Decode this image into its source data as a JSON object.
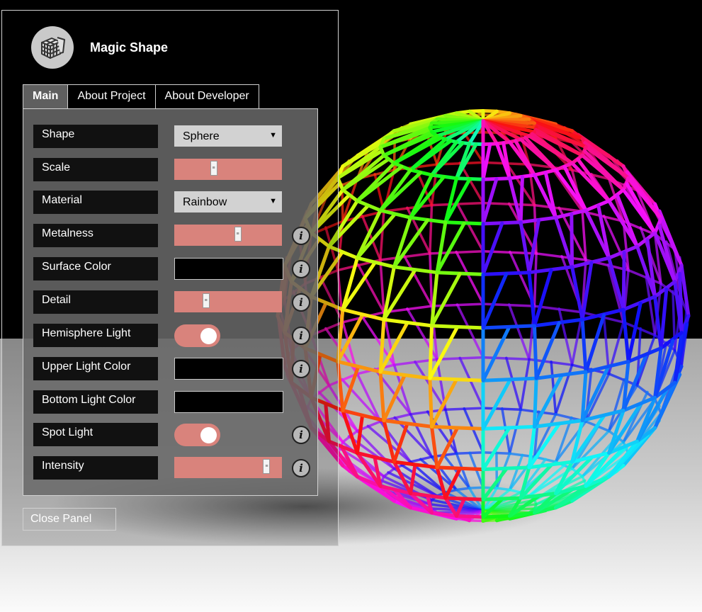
{
  "app": {
    "title": "Magic Shape",
    "logo_icon": "cube-logo-icon"
  },
  "tabs": [
    {
      "label": "Main",
      "active": true
    },
    {
      "label": "About Project",
      "active": false
    },
    {
      "label": "About Developer",
      "active": false
    }
  ],
  "controls": {
    "shape": {
      "label": "Shape",
      "value": "Sphere"
    },
    "scale": {
      "label": "Scale",
      "value": 0.35
    },
    "material": {
      "label": "Material",
      "value": "Rainbow"
    },
    "metalness": {
      "label": "Metalness",
      "value": 0.6
    },
    "surface_color": {
      "label": "Surface Color",
      "color": "#000000"
    },
    "detail": {
      "label": "Detail",
      "value": 0.27
    },
    "hemisphere_light": {
      "label": "Hemisphere Light",
      "on": true
    },
    "upper_light_color": {
      "label": "Upper Light Color",
      "color": "#000000"
    },
    "bottom_light_color": {
      "label": "Bottom Light Color",
      "color": "#000000"
    },
    "spot_light": {
      "label": "Spot Light",
      "on": true
    },
    "intensity": {
      "label": "Intensity",
      "value": 0.9
    }
  },
  "info_icon": "i",
  "close_label": "Close Panel",
  "colors": {
    "slider": "#d9837c",
    "toggle": "#d9837c",
    "panel_border": "#d0d0d0"
  }
}
